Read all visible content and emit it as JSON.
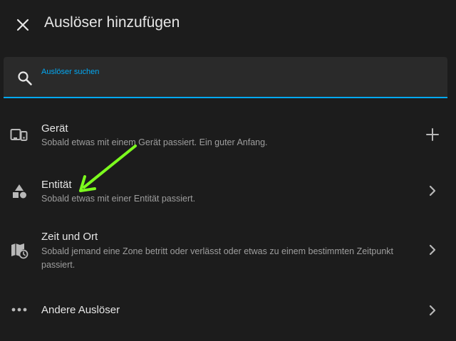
{
  "header": {
    "title": "Auslöser hinzufügen",
    "close_icon": "close-icon"
  },
  "search": {
    "label": "Auslöser suchen",
    "value": "",
    "icon": "search-icon",
    "accent_color": "#03a9f4"
  },
  "items": [
    {
      "title": "Gerät",
      "description": "Sobald etwas mit einem Gerät passiert. Ein guter Anfang.",
      "icon": "devices-icon",
      "action_icon": "plus-icon"
    },
    {
      "title": "Entität",
      "description": "Sobald etwas mit einer Entität passiert.",
      "icon": "shapes-icon",
      "action_icon": "chevron-right-icon"
    },
    {
      "title": "Zeit und Ort",
      "description": "Sobald jemand eine Zone betritt oder verlässt oder etwas zu einem bestimmten Zeitpunkt passiert.",
      "icon": "map-clock-icon",
      "action_icon": "chevron-right-icon"
    },
    {
      "title": "Andere Auslöser",
      "description": "",
      "icon": "dots-horizontal-icon",
      "action_icon": "chevron-right-icon"
    }
  ],
  "annotation": {
    "arrow_color": "#7cfc1e",
    "arrow_icon": "green-arrow-annotation"
  },
  "theme": {
    "background": "#1c1c1c",
    "surface": "#2a2a2a",
    "text_primary": "#e6e6e6",
    "text_secondary": "#9e9e9e",
    "icon_color": "#b8b8b8"
  }
}
